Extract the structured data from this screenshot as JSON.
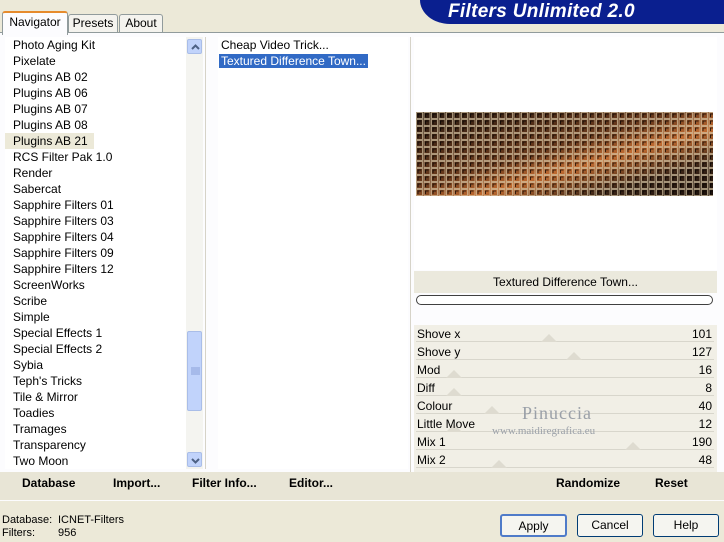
{
  "tabs": [
    {
      "label": "Navigator",
      "active": true
    },
    {
      "label": "Presets",
      "active": false
    },
    {
      "label": "About",
      "active": false
    }
  ],
  "banner": {
    "title": "Filters Unlimited 2.0"
  },
  "categories": {
    "items": [
      "Photo Aging Kit",
      "Pixelate",
      "Plugins AB 02",
      "Plugins AB 06",
      "Plugins AB 07",
      "Plugins AB 08",
      "Plugins AB 21",
      "RCS Filter Pak 1.0",
      "Render",
      "Sabercat",
      "Sapphire Filters 01",
      "Sapphire Filters 03",
      "Sapphire Filters 04",
      "Sapphire Filters 09",
      "Sapphire Filters 12",
      "ScreenWorks",
      "Scribe",
      "Simple",
      "Special Effects 1",
      "Special Effects 2",
      "Sybia",
      "Teph's Tricks",
      "Tile & Mirror",
      "Toadies",
      "Tramages",
      "Transparency",
      "Two Moon"
    ],
    "current_index": 6
  },
  "filters": {
    "items": [
      "Cheap Video Trick...",
      "Textured Difference Town..."
    ],
    "selected_index": 1
  },
  "preview": {
    "filter_name": "Textured Difference Town..."
  },
  "params": [
    {
      "label": "Shove x",
      "value": "101",
      "level": 0.396
    },
    {
      "label": "Shove y",
      "value": "127",
      "level": 0.498
    },
    {
      "label": "Mod",
      "value": "16",
      "level": 0
    },
    {
      "label": "Diff",
      "value": "8",
      "level": 0
    },
    {
      "label": "Colour",
      "value": "40",
      "level": 0.157
    },
    {
      "label": "Little Move",
      "value": "12",
      "level": 0
    },
    {
      "label": "Mix 1",
      "value": "190",
      "level": 0.745
    },
    {
      "label": "Mix 2",
      "value": "48",
      "level": 0.188
    }
  ],
  "watermark": {
    "name": "Pinuccia",
    "site": "www.maidiregrafica.eu"
  },
  "bottom_links": {
    "database": "Database",
    "import": "Import...",
    "filter_info": "Filter Info...",
    "editor": "Editor...",
    "randomize": "Randomize",
    "reset": "Reset"
  },
  "status": {
    "database_label": "Database:",
    "database_value": "ICNET-Filters",
    "filters_label": "Filters:",
    "filters_value": "956"
  },
  "buttons": {
    "apply": "Apply",
    "cancel": "Cancel",
    "help": "Help"
  }
}
